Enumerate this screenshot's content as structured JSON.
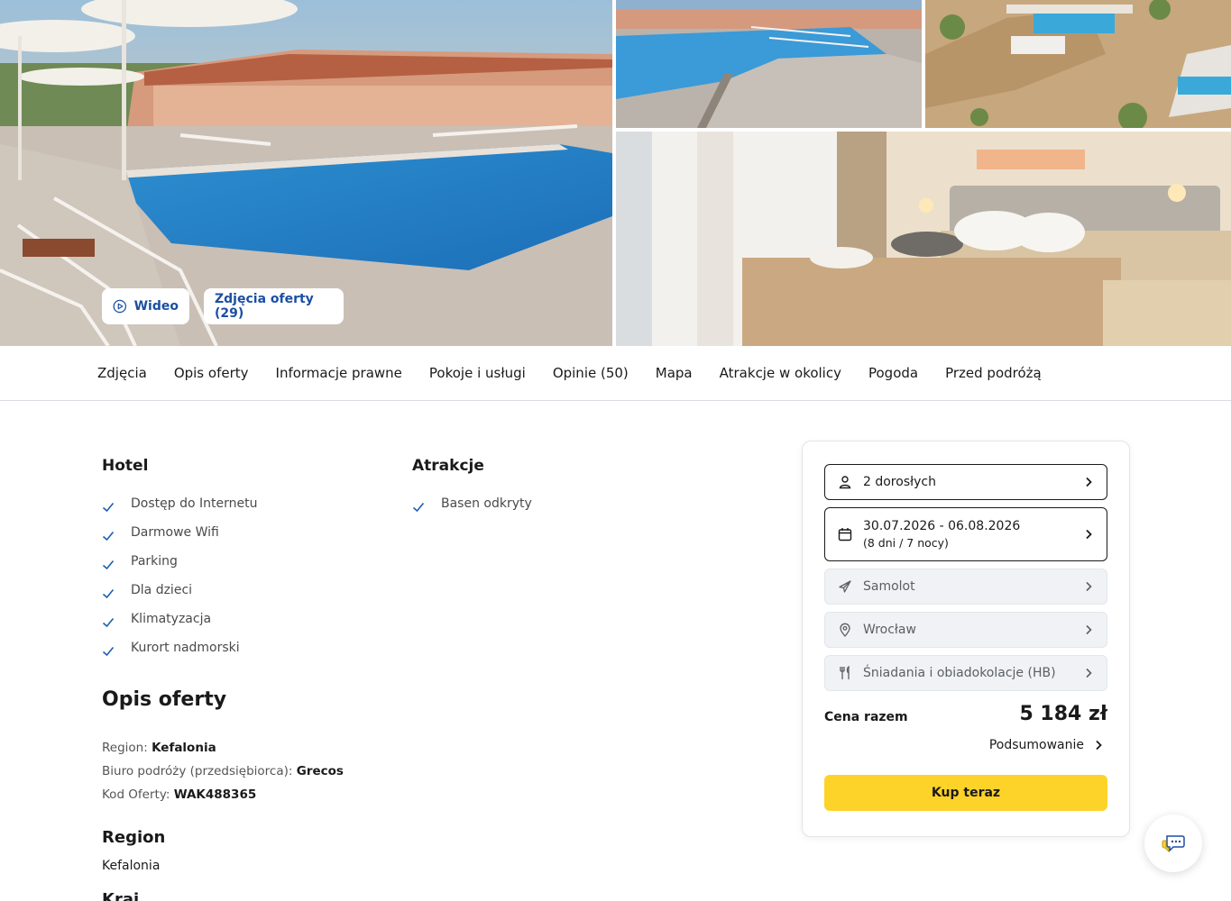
{
  "gallery": {
    "video_label": "Wideo",
    "photos_label": "Zdjęcia oferty (29)"
  },
  "tabs": [
    {
      "label": "Zdjęcia"
    },
    {
      "label": "Opis oferty"
    },
    {
      "label": "Informacje prawne"
    },
    {
      "label": "Pokoje i usługi"
    },
    {
      "label": "Opinie (50)"
    },
    {
      "label": "Mapa"
    },
    {
      "label": "Atrakcje w okolicy"
    },
    {
      "label": "Pogoda"
    },
    {
      "label": "Przed podróżą"
    }
  ],
  "hotel": {
    "title": "Hotel",
    "items": [
      "Dostęp do Internetu",
      "Darmowe Wifi",
      "Parking",
      "Dla dzieci",
      "Klimatyzacja",
      "Kurort nadmorski"
    ]
  },
  "attractions": {
    "title": "Atrakcje",
    "items": [
      "Basen odkryty"
    ]
  },
  "offer": {
    "title": "Opis oferty",
    "region_label": "Region:",
    "region_value": "Kefalonia",
    "agency_label": "Biuro podróży (przedsiębiorca):",
    "agency_value": "Grecos",
    "code_label": "Kod Oferty:",
    "code_value": "WAK488365"
  },
  "region_section": {
    "title": "Region",
    "value": "Kefalonia"
  },
  "next_section": {
    "title": "Kraj"
  },
  "booking": {
    "guests": "2 dorosłych",
    "dates": "30.07.2026 - 06.08.2026",
    "duration": "(8 dni / 7 nocy)",
    "transport": "Samolot",
    "departure": "Wrocław",
    "board": "Śniadania i obiadokolacje (HB)",
    "total_label": "Cena razem",
    "total_value": "5 184 zł",
    "summary_label": "Podsumowanie",
    "buy_label": "Kup teraz"
  },
  "colors": {
    "accent_blue": "#1b4fa3",
    "buy_yellow": "#fdd32a",
    "check_blue": "#1b5fb0"
  },
  "icons": [
    "play-icon",
    "check-icon",
    "user-icon",
    "calendar-icon",
    "plane-icon",
    "location-pin-icon",
    "cutlery-icon",
    "chevron-right-icon",
    "chat-icon"
  ]
}
